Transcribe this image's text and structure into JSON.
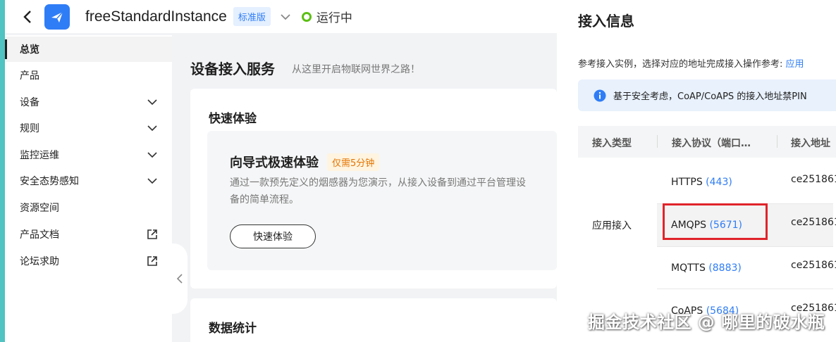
{
  "header": {
    "instance_name": "freeStandardInstance",
    "edition_badge": "标准版",
    "status_text": "运行中",
    "status_color": "#5cbf14",
    "accent_color": "#2f7df6"
  },
  "sidebar": {
    "items": [
      {
        "label": "总览",
        "active": true,
        "trail": ""
      },
      {
        "label": "产品",
        "trail": ""
      },
      {
        "label": "设备",
        "trail": "chevron-down-icon"
      },
      {
        "label": "规则",
        "trail": "chevron-down-icon"
      },
      {
        "label": "监控运维",
        "trail": "chevron-down-icon"
      },
      {
        "label": "安全态势感知",
        "trail": "chevron-down-icon"
      },
      {
        "label": "资源空间",
        "trail": ""
      },
      {
        "label": "产品文档",
        "trail": "external-link-icon"
      },
      {
        "label": "论坛求助",
        "trail": "external-link-icon"
      }
    ]
  },
  "main": {
    "title": "设备接入服务",
    "subtitle": "从这里开启物联网世界之路！",
    "quick": {
      "heading": "快速体验",
      "card_title": "向导式极速体验",
      "badge": "仅需5分钟",
      "desc": "通过一款预先定义的烟感器为您演示，从接入设备到通过平台管理设备的简单流程。",
      "button": "快速体验"
    },
    "stats_heading": "数据统计"
  },
  "drawer": {
    "title": "接入信息",
    "intro": "参考接入实例，选择对应的地址完成接入操作参考:",
    "intro_link": "应用",
    "notice": "基于安全考虑，CoAP/CoAPS 的接入地址禁PIN",
    "columns": [
      "接入类型",
      "接入协议（端口…",
      "接入地址"
    ],
    "type_label": "应用接入",
    "rows": [
      {
        "protocol": "HTTPS",
        "port": "(443)",
        "address": "ce251861"
      },
      {
        "protocol": "AMQPS",
        "port": "(5671)",
        "address": "ce251861"
      },
      {
        "protocol": "MQTTS",
        "port": "(8883)",
        "address": "ce251861"
      },
      {
        "protocol": "CoAPS",
        "port": "(5684)",
        "address": "ce251861"
      }
    ]
  },
  "watermark": "掘金技术社区 @ 哪里的破水瓶"
}
